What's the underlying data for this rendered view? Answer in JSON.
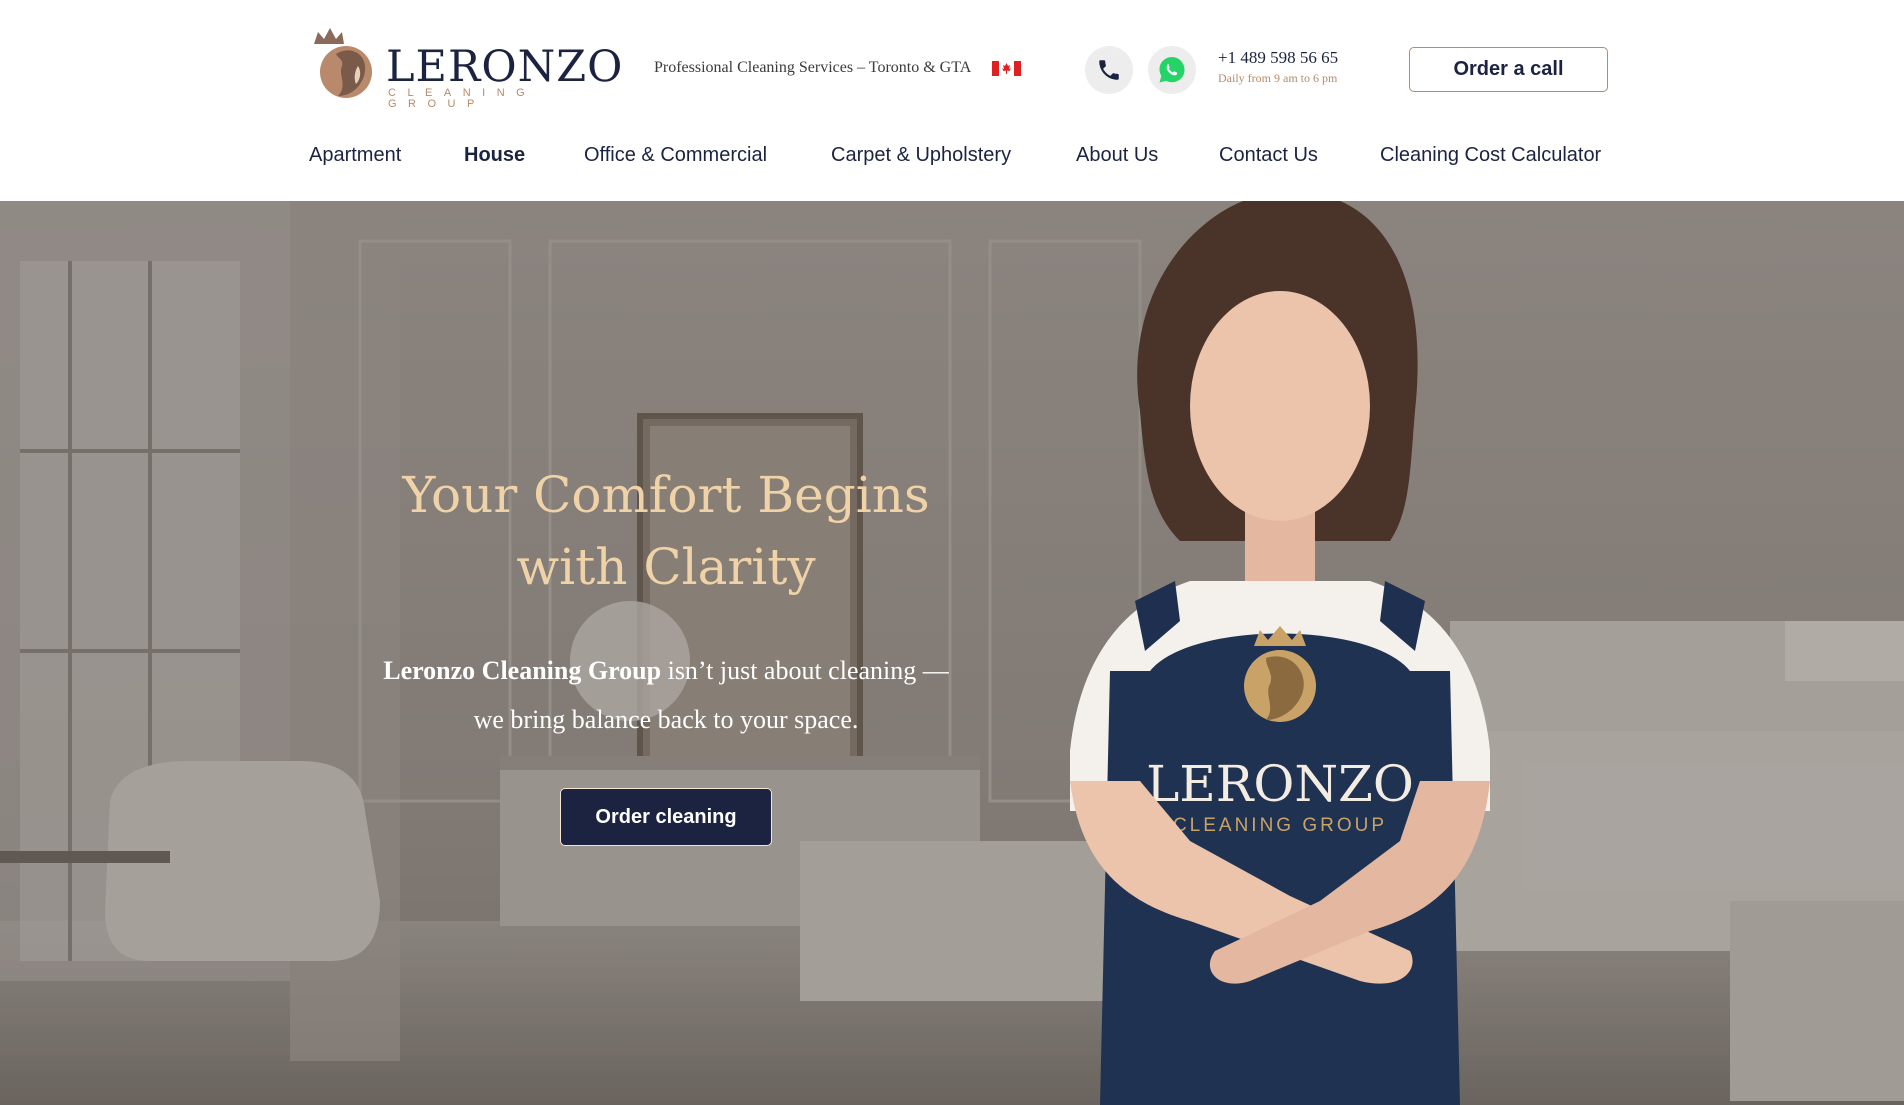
{
  "brand": {
    "name": "LERONZO",
    "subtitle": "CLEANING GROUP",
    "accent_color": "#b8896a",
    "navy_color": "#1c2341"
  },
  "header": {
    "tagline": "Professional Cleaning Services – Toronto & GTA",
    "flag_icon": "canada-flag-icon",
    "phone_icon": "phone-icon",
    "whatsapp_icon": "whatsapp-icon",
    "phone_number": "+1 489 598 56 65",
    "hours": "Daily from 9 am to 6 pm",
    "cta_label": "Order a call"
  },
  "nav": {
    "items": [
      {
        "label": "Apartment",
        "active": false
      },
      {
        "label": "House",
        "active": true
      },
      {
        "label": "Office & Commercial",
        "active": false
      },
      {
        "label": "Carpet & Upholstery",
        "active": false
      },
      {
        "label": "About Us",
        "active": false
      },
      {
        "label": "Contact Us",
        "active": false
      },
      {
        "label": "Cleaning Cost Calculator",
        "active": false
      }
    ]
  },
  "hero": {
    "title_line1": "Your Comfort Begins",
    "title_line2": "with Clarity",
    "subtitle_bold": "Leronzo Cleaning Group",
    "subtitle_rest1": " isn’t just about cleaning —",
    "subtitle_line2": "we bring balance back to your space.",
    "cta_label": "Order cleaning",
    "apron_brand": "LERONZO",
    "apron_sub": "CLEANING GROUP"
  }
}
